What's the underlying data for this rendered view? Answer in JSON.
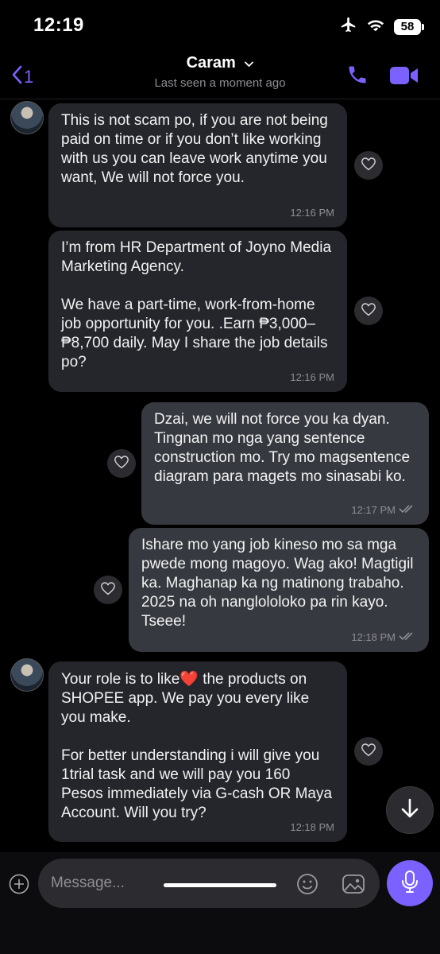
{
  "status": {
    "time": "12:19",
    "battery": "58"
  },
  "header": {
    "back_count": "1",
    "contact_name": "Caram",
    "last_seen": "Last seen a moment ago"
  },
  "messages": [
    {
      "direction": "in",
      "text": "This is not scam po, if you are not being paid on time or if you don’t like working with us you can leave work anytime you want, We will not force you.",
      "time": "12:16 PM"
    },
    {
      "direction": "in",
      "text": "I’m from HR Department of Joyno Media Marketing Agency.\n\nWe have a part-time, work-from-home job opportunity for you. .Earn ₱3,000–₱8,700 daily. May I share the job details po?",
      "time": "12:16 PM"
    },
    {
      "direction": "out",
      "text": "Dzai, we will not force you ka dyan. Tingnan mo nga yang sentence construction mo. Try mo magsentence diagram para magets mo sinasabi ko.",
      "time": "12:17 PM"
    },
    {
      "direction": "out",
      "text": "Ishare mo yang job kineso mo sa mga pwede mong magoyo. Wag ako! Magtigil ka. Maghanap ka ng matinong trabaho. 2025 na oh nanglololoko pa rin kayo. Tseee!",
      "time": "12:18 PM"
    },
    {
      "direction": "in",
      "text_before_emoji": "Your role is to like",
      "emoji": "❤️",
      "text_after_emoji": " the products on SHOPEE app. We pay you every like you make.\n\nFor better understanding i will give you 1trial task and we will pay you 160 Pesos immediately via G-cash OR Maya Account. Will you try?",
      "time": "12:18 PM"
    }
  ],
  "composer": {
    "placeholder": "Message..."
  },
  "colors": {
    "accent": "#7b61ff",
    "incoming_bubble": "#24262b",
    "outgoing_bubble": "#36393f",
    "background": "#000000"
  },
  "icons": [
    "airplane-icon",
    "wifi-icon",
    "back-chevron-icon",
    "chevron-down-icon",
    "phone-icon",
    "video-icon",
    "heart-icon",
    "read-receipt-icon",
    "arrow-down-icon",
    "plus-icon",
    "emoji-icon",
    "gallery-icon",
    "microphone-icon"
  ]
}
